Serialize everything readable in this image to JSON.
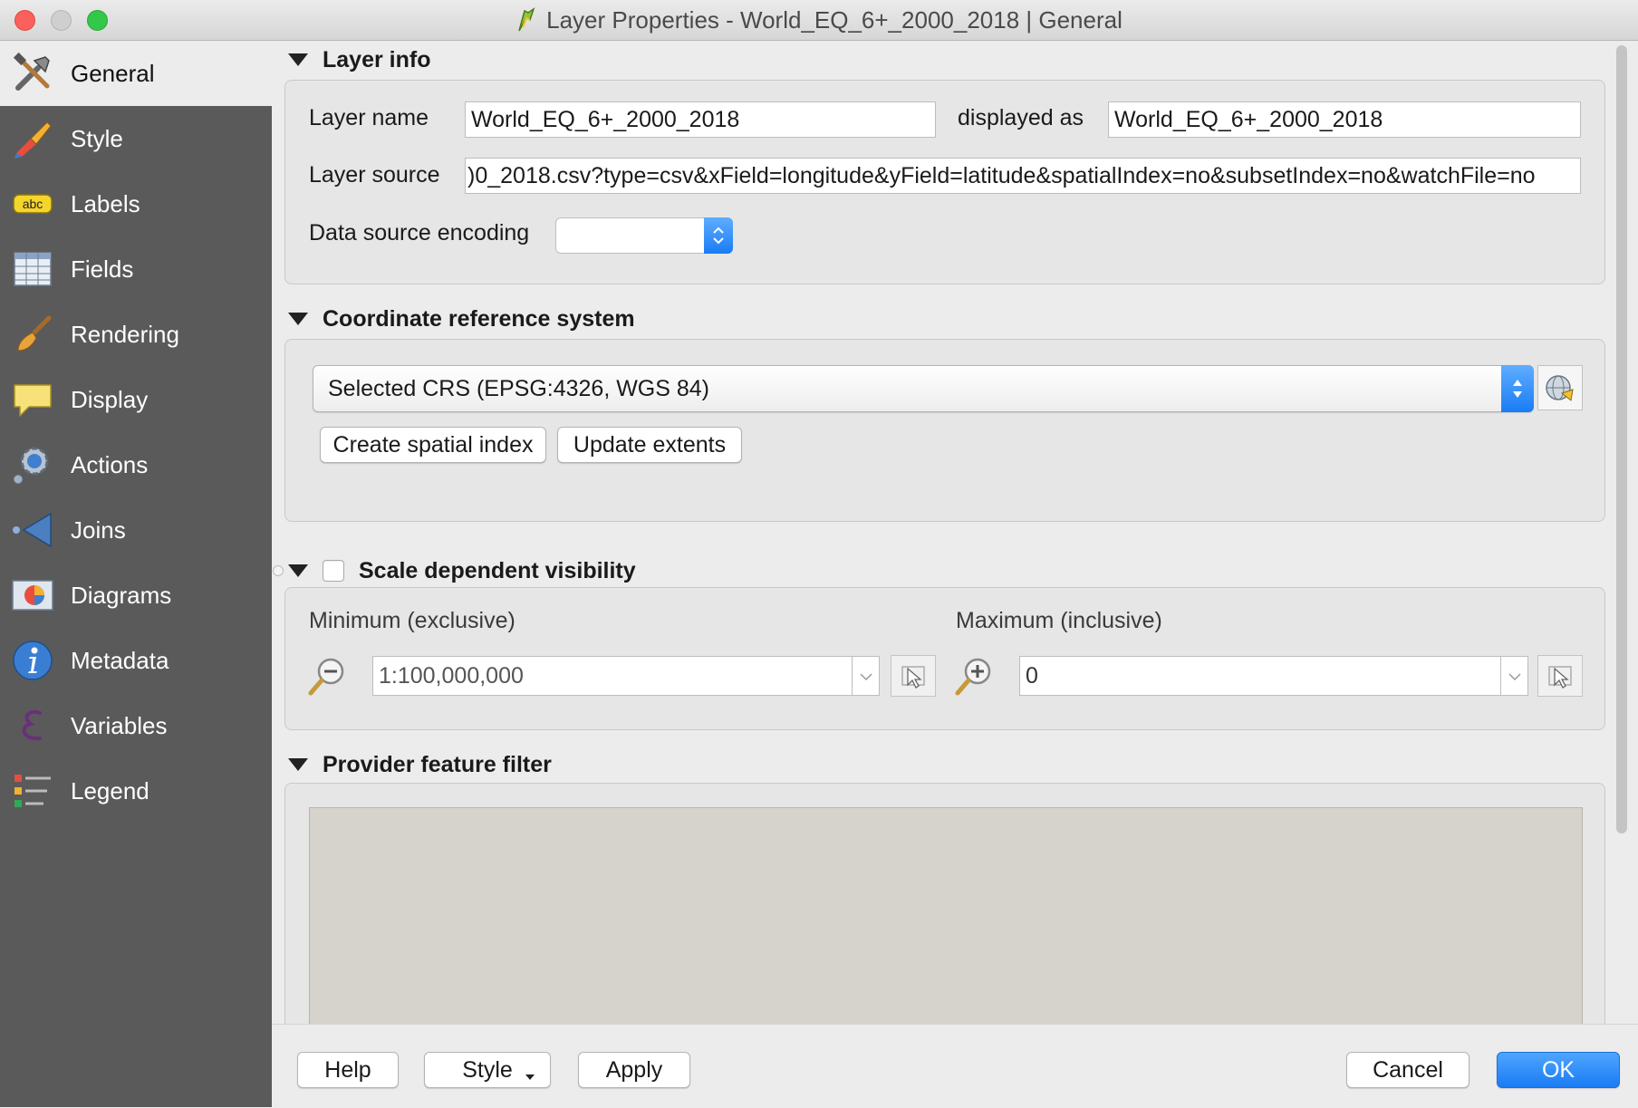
{
  "window": {
    "title": "Layer Properties - World_EQ_6+_2000_2018 | General"
  },
  "sidebar": {
    "items": [
      {
        "label": "General",
        "icon": "tools-icon",
        "active": true
      },
      {
        "label": "Style",
        "icon": "paintbrush-icon"
      },
      {
        "label": "Labels",
        "icon": "labels-icon"
      },
      {
        "label": "Fields",
        "icon": "table-icon"
      },
      {
        "label": "Rendering",
        "icon": "brush-icon"
      },
      {
        "label": "Display",
        "icon": "speech-bubble-icon"
      },
      {
        "label": "Actions",
        "icon": "gear-icon"
      },
      {
        "label": "Joins",
        "icon": "joins-icon"
      },
      {
        "label": "Diagrams",
        "icon": "pie-chart-icon"
      },
      {
        "label": "Metadata",
        "icon": "info-icon"
      },
      {
        "label": "Variables",
        "icon": "epsilon-icon"
      },
      {
        "label": "Legend",
        "icon": "legend-icon"
      }
    ],
    "abc": "abc"
  },
  "layer_info": {
    "title": "Layer info",
    "name_label": "Layer name",
    "name_value": "World_EQ_6+_2000_2018",
    "displayed_as_label": "displayed as",
    "displayed_as_value": "World_EQ_6+_2000_2018",
    "source_label": "Layer source",
    "source_value": ")0_2018.csv?type=csv&xField=longitude&yField=latitude&spatialIndex=no&subsetIndex=no&watchFile=no",
    "encoding_label": "Data source encoding",
    "encoding_value": ""
  },
  "crs": {
    "title": "Coordinate reference system",
    "selected": "Selected CRS (EPSG:4326, WGS 84)",
    "create_index_label": "Create spatial index",
    "update_extents_label": "Update extents"
  },
  "scale": {
    "title": "Scale dependent visibility",
    "checked": false,
    "min_label": "Minimum (exclusive)",
    "min_value": "1:100,000,000",
    "max_label": "Maximum (inclusive)",
    "max_value": "0"
  },
  "filter": {
    "title": "Provider feature filter",
    "expression": ""
  },
  "footer": {
    "help": "Help",
    "style": "Style",
    "apply": "Apply",
    "cancel": "Cancel",
    "ok": "OK"
  },
  "colors": {
    "sidebar_bg": "#5a5a5a",
    "accent": "#1a7cf4",
    "close": "#fc605c",
    "maximize": "#34c84a"
  }
}
